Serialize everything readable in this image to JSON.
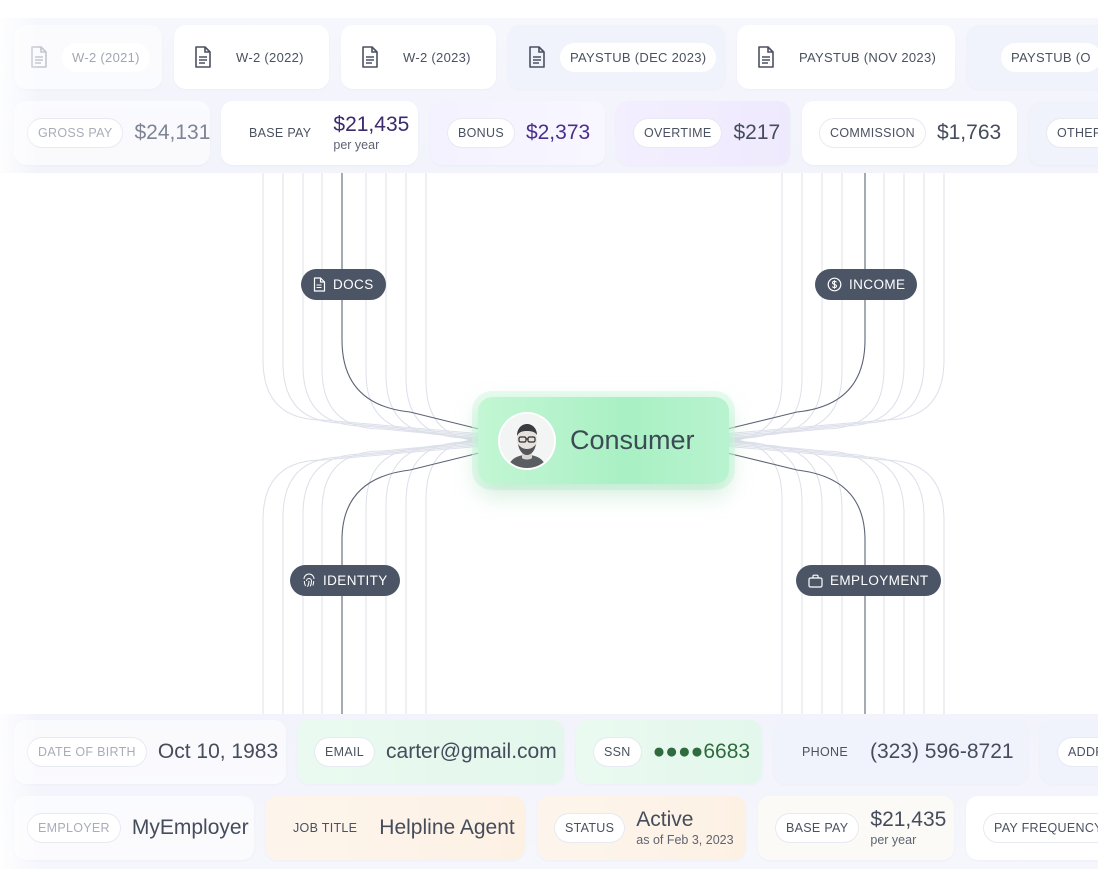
{
  "documents": [
    {
      "label": "W-2 (2021)",
      "icon": "document-icon"
    },
    {
      "label": "W-2 (2022)",
      "icon": "document-icon"
    },
    {
      "label": "W-2 (2023)",
      "icon": "document-icon"
    },
    {
      "label": "PAYSTUB  (DEC 2023)",
      "icon": "document-icon"
    },
    {
      "label": "PAYSTUB  (NOV 2023)",
      "icon": "document-icon"
    },
    {
      "label": "PAYSTUB  (O",
      "icon": "document-icon"
    }
  ],
  "income": [
    {
      "label": "GROSS PAY",
      "value": "$24,131"
    },
    {
      "label": "BASE PAY",
      "value": "$21,435",
      "sub": "per year"
    },
    {
      "label": "BONUS",
      "value": "$2,373"
    },
    {
      "label": "OVERTIME",
      "value": "$217"
    },
    {
      "label": "COMMISSION",
      "value": "$1,763"
    },
    {
      "label": "OTHER",
      "value": ""
    }
  ],
  "identity": [
    {
      "label": "DATE OF BIRTH",
      "value": "Oct 10, 1983"
    },
    {
      "label": "EMAIL",
      "value": "carter@gmail.com"
    },
    {
      "label": "SSN",
      "value": "●●●●6683"
    },
    {
      "label": "PHONE",
      "value": "(323) 596-8721"
    },
    {
      "label": "ADDR",
      "value": ""
    }
  ],
  "employment": [
    {
      "label": "EMPLOYER",
      "value": "MyEmployer"
    },
    {
      "label": "JOB TITLE",
      "value": "Helpline Agent"
    },
    {
      "label": "STATUS",
      "value": "Active",
      "sub": "as of Feb 3, 2023"
    },
    {
      "label": "BASE PAY",
      "value": "$21,435",
      "sub": "per year"
    },
    {
      "label": "PAY FREQUENCY",
      "value": ""
    }
  ],
  "nodes": {
    "docs": {
      "label": "DOCS",
      "icon": "document-icon"
    },
    "income": {
      "label": "INCOME",
      "icon": "dollar-coin-icon"
    },
    "identity": {
      "label": "IDENTITY",
      "icon": "fingerprint-icon"
    },
    "employment": {
      "label": "EMPLOYMENT",
      "icon": "briefcase-icon"
    }
  },
  "consumer": {
    "title": "Consumer",
    "icon": "avatar-portrait"
  },
  "colors": {
    "node_bg": "#4b5566",
    "consumer_green": "#a9f0c4",
    "accent_purple": "#4a2f8a",
    "ssn_green": "#2f6b3e"
  }
}
